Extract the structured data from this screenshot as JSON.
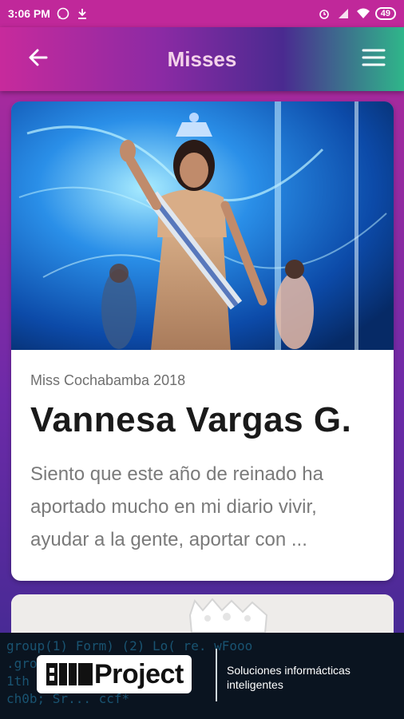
{
  "status_bar": {
    "time": "3:06 PM",
    "battery": "49",
    "icons": [
      "whatsapp-icon",
      "download-icon",
      "alarm-icon",
      "signal-icon",
      "wifi-icon",
      "battery-icon"
    ]
  },
  "app_bar": {
    "title": "Misses",
    "back_icon": "arrow-left-icon",
    "menu_icon": "hamburger-menu-icon"
  },
  "cards": [
    {
      "subtitle": "Miss Cochabamba 2018",
      "title": "Vannesa Vargas G.",
      "excerpt": "Siento que este año de reinado ha aportado mucho en mi diario vivir, ayudar a la gente, aportar con ...",
      "image": "crowned-miss-photo"
    },
    {
      "image": "crown-photo"
    }
  ],
  "ad": {
    "brand": "Project",
    "tagline_line1": "Soluciones informácticas",
    "tagline_line2": "inteligentes"
  },
  "colors": {
    "status_bar": "#c0289a",
    "app_bar_start": "#c72a9c",
    "app_bar_end": "#2fb68a",
    "title": "#f4d2ea",
    "card_bg": "#ffffff"
  }
}
